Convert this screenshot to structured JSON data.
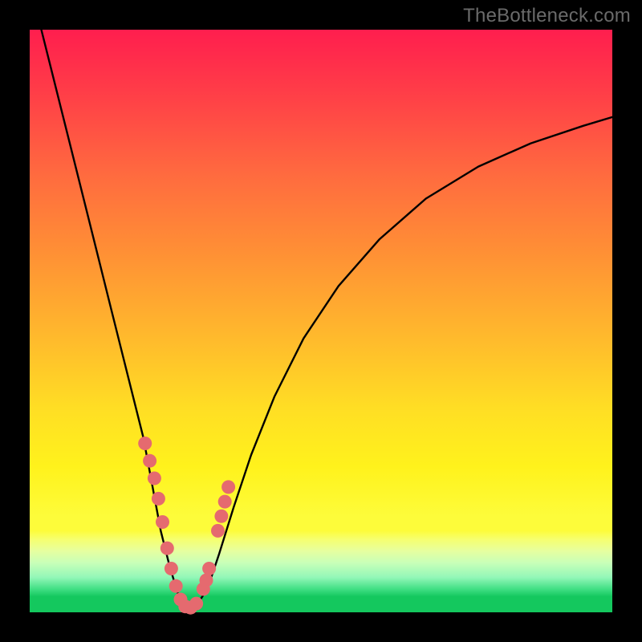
{
  "watermark": "TheBottleneck.com",
  "colors": {
    "background": "#000000",
    "curve": "#000000",
    "marker": "#e56a6f",
    "gradient_top": "#ff1e4e",
    "gradient_bottom": "#14c85e"
  },
  "chart_data": {
    "type": "line",
    "title": "",
    "xlabel": "",
    "ylabel": "",
    "xlim": [
      0,
      100
    ],
    "ylim": [
      0,
      100
    ],
    "grid": false,
    "legend": false,
    "note": "V-shaped bottleneck curve on a red→green vertical gradient. Values are visual estimates (chart has no numeric labels).",
    "series": [
      {
        "name": "bottleneck-curve",
        "x": [
          2,
          5,
          8,
          11,
          14,
          17,
          19.5,
          21,
          22.5,
          24,
          25.5,
          27,
          28.5,
          30.5,
          32.5,
          35,
          38,
          42,
          47,
          53,
          60,
          68,
          77,
          86,
          95,
          100
        ],
        "y": [
          100,
          88,
          76,
          64,
          52,
          40,
          30,
          22,
          14,
          8,
          3,
          0.5,
          1,
          4,
          10,
          18,
          27,
          37,
          47,
          56,
          64,
          71,
          76.5,
          80.5,
          83.5,
          85
        ]
      }
    ],
    "markers": {
      "name": "highlight-points",
      "color": "#e56a6f",
      "x": [
        19.8,
        20.6,
        21.4,
        22.1,
        22.8,
        23.6,
        24.3,
        25.1,
        25.9,
        26.7,
        27.6,
        28.6,
        29.8,
        30.3,
        30.8,
        32.3,
        32.9,
        33.5,
        34.1
      ],
      "y": [
        29,
        26,
        23,
        19.5,
        15.5,
        11,
        7.5,
        4.5,
        2.2,
        1,
        0.8,
        1.5,
        4,
        5.5,
        7.5,
        14,
        16.5,
        19,
        21.5
      ]
    }
  }
}
